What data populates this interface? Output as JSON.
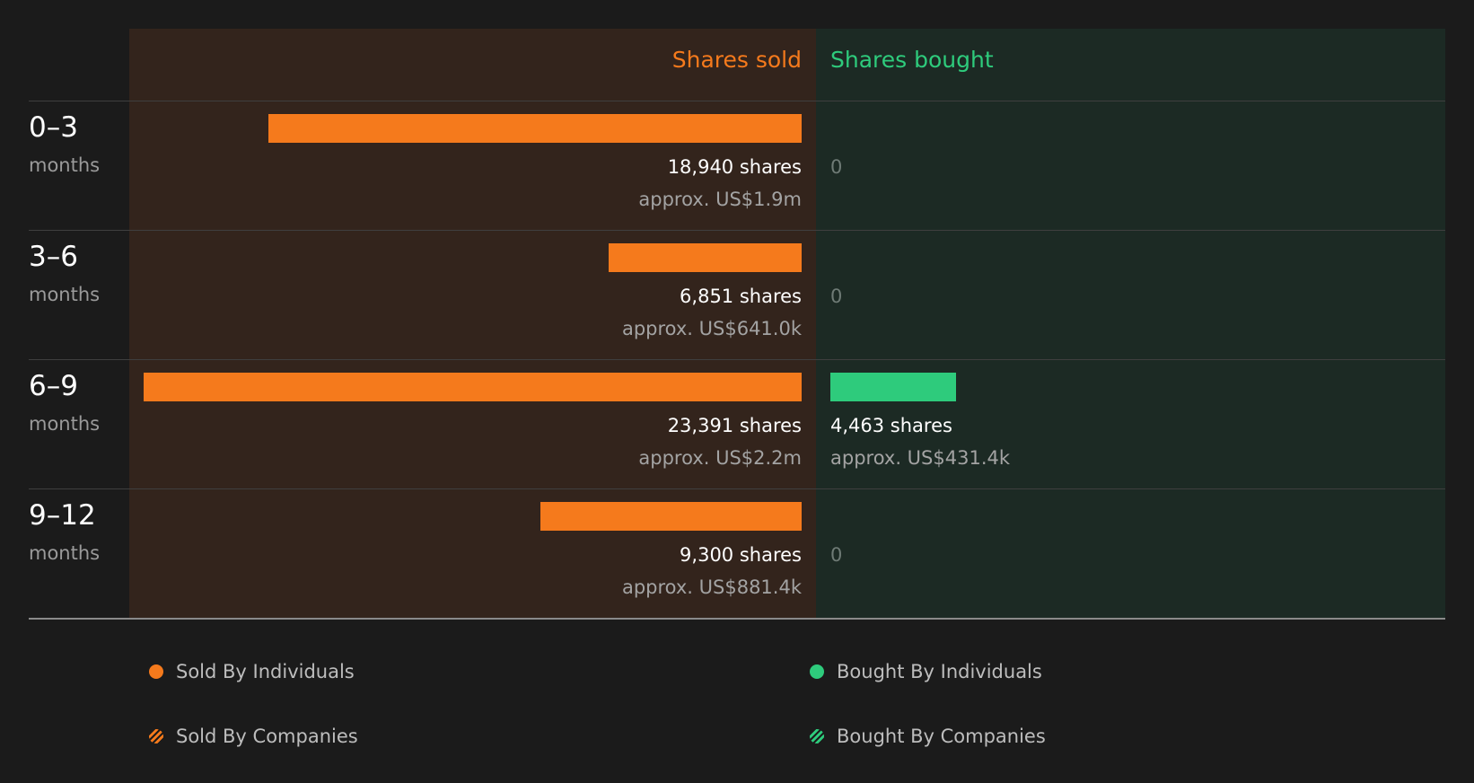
{
  "chart_data": {
    "type": "bar",
    "orientation": "horizontal-diverging",
    "columns": {
      "sold_header": "Shares sold",
      "bought_header": "Shares bought"
    },
    "categories": [
      {
        "period": "0–3",
        "unit": "months"
      },
      {
        "period": "3–6",
        "unit": "months"
      },
      {
        "period": "6–9",
        "unit": "months"
      },
      {
        "period": "9–12",
        "unit": "months"
      }
    ],
    "series": [
      {
        "name": "Shares sold",
        "color": "#f57a1c",
        "values": [
          18940,
          6851,
          23391,
          9300
        ],
        "shares_labels": [
          "18,940 shares",
          "6,851 shares",
          "23,391 shares",
          "9,300 shares"
        ],
        "value_labels": [
          "approx. US$1.9m",
          "approx. US$641.0k",
          "approx. US$2.2m",
          "approx. US$881.4k"
        ]
      },
      {
        "name": "Shares bought",
        "color": "#2ecb7c",
        "values": [
          0,
          0,
          4463,
          0
        ],
        "shares_labels": [
          "0",
          "0",
          "4,463 shares",
          "0"
        ],
        "value_labels": [
          "",
          "",
          "approx. US$431.4k",
          ""
        ]
      }
    ],
    "legend": [
      {
        "label": "Sold By Individuals",
        "color": "#f57a1c",
        "marker": "solid-dot"
      },
      {
        "label": "Bought By Individuals",
        "color": "#2ecb7c",
        "marker": "solid-dot"
      },
      {
        "label": "Sold By Companies",
        "color": "#f57a1c",
        "marker": "hatched-dot"
      },
      {
        "label": "Bought By Companies",
        "color": "#2ecb7c",
        "marker": "hatched-dot"
      }
    ],
    "legend_position": "bottom",
    "grid": false
  }
}
